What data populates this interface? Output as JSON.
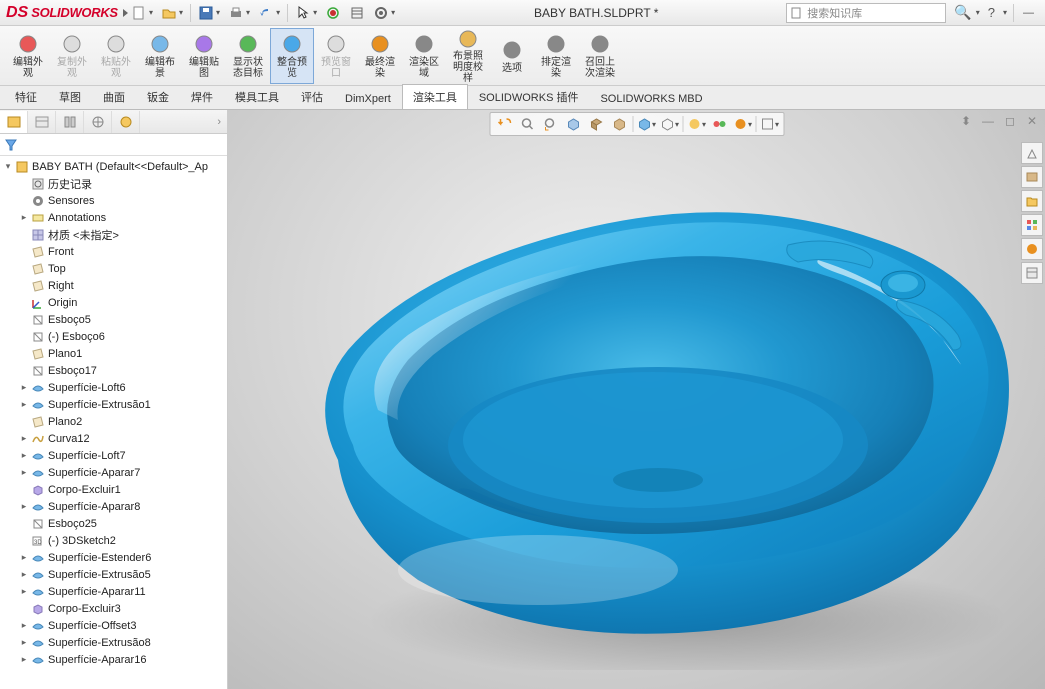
{
  "app": {
    "name": "SOLIDWORKS",
    "doc_title": "BABY BATH.SLDPRT *",
    "search_placeholder": "搜索知识库",
    "help_q": "?"
  },
  "cmdmgr": [
    {
      "label": "编辑外\n观",
      "dim": false
    },
    {
      "label": "复制外\n观",
      "dim": true
    },
    {
      "label": "粘贴外\n观",
      "dim": true
    },
    {
      "label": "编辑布\n景",
      "dim": false
    },
    {
      "label": "编辑贴\n图",
      "dim": false
    },
    {
      "label": "显示状\n态目标",
      "dim": false
    },
    {
      "label": "整合预\n览",
      "dim": false,
      "sel": true
    },
    {
      "label": "预览窗\n口",
      "dim": true
    },
    {
      "label": "最终渲\n染",
      "dim": false
    },
    {
      "label": "渲染区\n域",
      "dim": false
    },
    {
      "label": "布景照\n明度校\n样",
      "dim": false
    },
    {
      "label": "选项",
      "dim": false
    },
    {
      "label": "排定渲\n染",
      "dim": false
    },
    {
      "label": "召回上\n次渲染",
      "dim": false
    }
  ],
  "tabs": [
    "特征",
    "草图",
    "曲面",
    "钣金",
    "焊件",
    "模具工具",
    "评估",
    "DimXpert",
    "渲染工具",
    "SOLIDWORKS 插件",
    "SOLIDWORKS MBD"
  ],
  "active_tab": 8,
  "tree_root": "BABY BATH  (Default<<Default>_Ap",
  "tree": [
    {
      "ic": "hist",
      "lbl": "历史记录",
      "d": 1
    },
    {
      "ic": "sensor",
      "lbl": "Sensores",
      "d": 1
    },
    {
      "ic": "ann",
      "lbl": "Annotations",
      "d": 1,
      "exp": true
    },
    {
      "ic": "mat",
      "lbl": "材质 <未指定>",
      "d": 1
    },
    {
      "ic": "plane",
      "lbl": "Front",
      "d": 1
    },
    {
      "ic": "plane",
      "lbl": "Top",
      "d": 1
    },
    {
      "ic": "plane",
      "lbl": "Right",
      "d": 1
    },
    {
      "ic": "origin",
      "lbl": "Origin",
      "d": 1
    },
    {
      "ic": "sketch",
      "lbl": "Esboço5",
      "d": 1
    },
    {
      "ic": "sketch",
      "lbl": "(-) Esboço6",
      "d": 1
    },
    {
      "ic": "plane",
      "lbl": "Plano1",
      "d": 1
    },
    {
      "ic": "sketch",
      "lbl": "Esboço17",
      "d": 1
    },
    {
      "ic": "surf",
      "lbl": "Superfície-Loft6",
      "d": 1,
      "exp": true
    },
    {
      "ic": "surf",
      "lbl": "Superfície-Extrusão1",
      "d": 1,
      "exp": true
    },
    {
      "ic": "plane",
      "lbl": "Plano2",
      "d": 1
    },
    {
      "ic": "curve",
      "lbl": "Curva12",
      "d": 1,
      "exp": true
    },
    {
      "ic": "surf",
      "lbl": "Superfície-Loft7",
      "d": 1,
      "exp": true
    },
    {
      "ic": "surf",
      "lbl": "Superfície-Aparar7",
      "d": 1,
      "exp": true
    },
    {
      "ic": "body",
      "lbl": "Corpo-Excluir1",
      "d": 1
    },
    {
      "ic": "surf",
      "lbl": "Superfície-Aparar8",
      "d": 1,
      "exp": true
    },
    {
      "ic": "sketch",
      "lbl": "Esboço25",
      "d": 1
    },
    {
      "ic": "3ds",
      "lbl": "(-) 3DSketch2",
      "d": 1
    },
    {
      "ic": "surf",
      "lbl": "Superfície-Estender6",
      "d": 1,
      "exp": true
    },
    {
      "ic": "surf",
      "lbl": "Superfície-Extrusão5",
      "d": 1,
      "exp": true
    },
    {
      "ic": "surf",
      "lbl": "Superfície-Aparar11",
      "d": 1,
      "exp": true
    },
    {
      "ic": "body",
      "lbl": "Corpo-Excluir3",
      "d": 1
    },
    {
      "ic": "surf",
      "lbl": "Superfície-Offset3",
      "d": 1,
      "exp": true
    },
    {
      "ic": "surf",
      "lbl": "Superfície-Extrusão8",
      "d": 1,
      "exp": true
    },
    {
      "ic": "surf",
      "lbl": "Superfície-Aparar16",
      "d": 1,
      "exp": true
    }
  ],
  "colors": {
    "brand": "#d4002a",
    "tub": "#1a9dd9",
    "tub_dark": "#0d6fa8",
    "tub_light": "#6ecdf7"
  }
}
